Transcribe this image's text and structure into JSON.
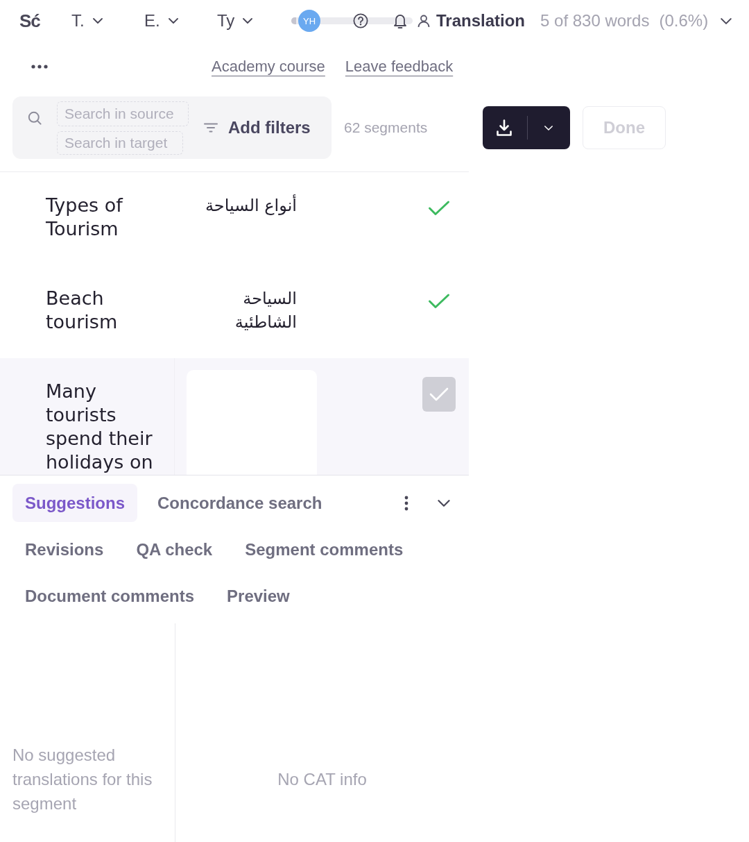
{
  "header": {
    "logo": "Sć",
    "menus": [
      {
        "label": "T."
      },
      {
        "label": "E."
      },
      {
        "label": "Ty"
      }
    ],
    "avatar": {
      "initials": "YH"
    },
    "progress": {
      "level": 0.04
    },
    "stage": "Translation",
    "word_count": "5 of 830 words",
    "percent": "(0.6%)"
  },
  "links": [
    "Academy course",
    "Leave feedback"
  ],
  "toolbar": {
    "search_fields": [
      {
        "placeholder": "Search in source"
      },
      {
        "placeholder": "Search in target"
      }
    ],
    "filters_button": "Add filters",
    "segment_count": "62 segments",
    "done_button": {
      "label": "Done",
      "disabled": true
    }
  },
  "segments": [
    {
      "source": "Types of Tourism",
      "target": "أنواع السياحة",
      "confirmed": true,
      "selected": false
    },
    {
      "source": "Beach tourism",
      "target": "السياحة الشاطئية",
      "confirmed": true,
      "selected": false
    },
    {
      "source": "Many tourists spend their holidays on",
      "confirmed": false,
      "selected": true
    }
  ],
  "panel": {
    "tabs": [
      {
        "label": "Suggestions",
        "selected": true
      },
      {
        "label": "Concordance search",
        "selected": false
      },
      {
        "label": "Revisions",
        "selected": false
      },
      {
        "label": "QA check",
        "selected": false
      },
      {
        "label": "Segment comments",
        "selected": false
      },
      {
        "label": "Document comments",
        "selected": false
      },
      {
        "label": "Preview",
        "selected": false
      }
    ],
    "suggestions_message": "No suggested translations for this segment",
    "cat_message": "No CAT info"
  }
}
